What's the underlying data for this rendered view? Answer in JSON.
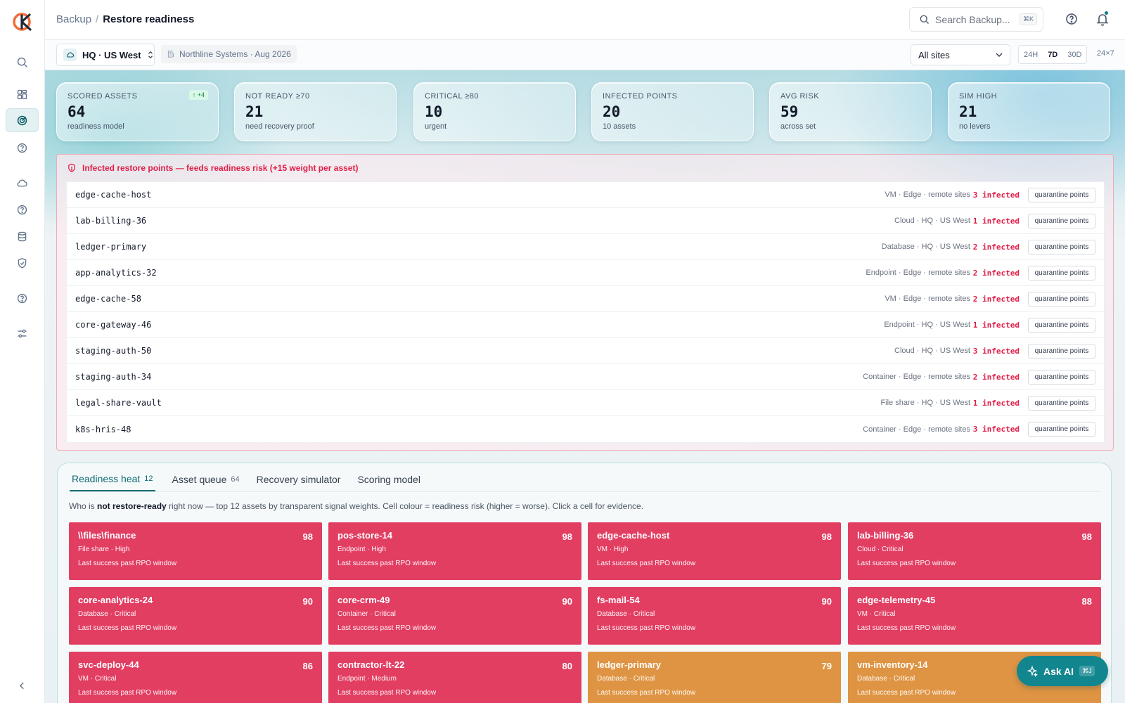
{
  "header": {
    "breadcrumb_parent": "Backup",
    "breadcrumb_separator": "/",
    "breadcrumb_current": "Restore readiness",
    "search_placeholder": "Search Backup...",
    "search_shortcut": "⌘K"
  },
  "subbar": {
    "site_label": "HQ · US West",
    "org_label": "Northline Systems · Aug 2026",
    "sites_filter": "All sites",
    "ranges": [
      "24H",
      "7D",
      "30D"
    ],
    "active_range": "7D",
    "range_extra": "24×7"
  },
  "sidebar": {
    "icons": [
      "logo-icon",
      "search-icon",
      "dashboard-icon",
      "readiness-target-icon",
      "help-circle-icon",
      "cloud-icon",
      "help-circle-icon",
      "database-icon",
      "shield-check-icon",
      "help-circle-icon",
      "sliders-icon",
      "collapse-chevron-icon"
    ]
  },
  "kpis": [
    {
      "label": "SCORED ASSETS",
      "value": "64",
      "sub": "readiness model",
      "delta": "↑ +4"
    },
    {
      "label": "NOT READY ≥70",
      "value": "21",
      "sub": "need recovery proof"
    },
    {
      "label": "CRITICAL ≥80",
      "value": "10",
      "sub": "urgent"
    },
    {
      "label": "INFECTED POINTS",
      "value": "20",
      "sub": "10 assets"
    },
    {
      "label": "AVG RISK",
      "value": "59",
      "sub": "across set"
    },
    {
      "label": "SIM HIGH",
      "value": "21",
      "sub": "no levers"
    }
  ],
  "infected": {
    "title": "Infected restore points — feeds readiness risk (+15 weight per asset)",
    "action_label": "quarantine points",
    "rows": [
      {
        "name": "edge-cache-host",
        "meta": "VM · Edge · remote sites",
        "count": "3 infected"
      },
      {
        "name": "lab-billing-36",
        "meta": "Cloud · HQ · US West",
        "count": "1 infected"
      },
      {
        "name": "ledger-primary",
        "meta": "Database · HQ · US West",
        "count": "2 infected"
      },
      {
        "name": "app-analytics-32",
        "meta": "Endpoint · Edge · remote sites",
        "count": "2 infected"
      },
      {
        "name": "edge-cache-58",
        "meta": "VM · Edge · remote sites",
        "count": "2 infected"
      },
      {
        "name": "core-gateway-46",
        "meta": "Endpoint · HQ · US West",
        "count": "1 infected"
      },
      {
        "name": "staging-auth-50",
        "meta": "Cloud · HQ · US West",
        "count": "3 infected"
      },
      {
        "name": "staging-auth-34",
        "meta": "Container · Edge · remote sites",
        "count": "2 infected"
      },
      {
        "name": "legal-share-vault",
        "meta": "File share · HQ · US West",
        "count": "1 infected"
      },
      {
        "name": "k8s-hris-48",
        "meta": "Container · Edge · remote sites",
        "count": "3 infected"
      }
    ]
  },
  "tabs": [
    {
      "label": "Readiness heat",
      "count": "12",
      "active": true
    },
    {
      "label": "Asset queue",
      "count": "64"
    },
    {
      "label": "Recovery simulator",
      "count": ""
    },
    {
      "label": "Scoring model",
      "count": ""
    }
  ],
  "heat": {
    "desc_prefix": "Who is ",
    "desc_bold": "not restore-ready",
    "desc_suffix": " right now — top 12 assets by transparent signal weights. Cell colour = readiness risk (higher = worse). Click a cell for evidence.",
    "cells": [
      {
        "name": "\\\\files\\finance",
        "score": "98",
        "meta": "File share · High",
        "note": "Last success past RPO window",
        "color": "#e23e62"
      },
      {
        "name": "pos-store-14",
        "score": "98",
        "meta": "Endpoint · High",
        "note": "Last success past RPO window",
        "color": "#e23e62"
      },
      {
        "name": "edge-cache-host",
        "score": "98",
        "meta": "VM · High",
        "note": "Last success past RPO window",
        "color": "#e23e62"
      },
      {
        "name": "lab-billing-36",
        "score": "98",
        "meta": "Cloud · Critical",
        "note": "Last success past RPO window",
        "color": "#e23e62"
      },
      {
        "name": "core-analytics-24",
        "score": "90",
        "meta": "Database · Critical",
        "note": "Last success past RPO window",
        "color": "#e23e62"
      },
      {
        "name": "core-crm-49",
        "score": "90",
        "meta": "Container · Critical",
        "note": "Last success past RPO window",
        "color": "#e23e62"
      },
      {
        "name": "fs-mail-54",
        "score": "90",
        "meta": "Database · Critical",
        "note": "Last success past RPO window",
        "color": "#e23e62"
      },
      {
        "name": "edge-telemetry-45",
        "score": "88",
        "meta": "VM · Critical",
        "note": "Last success past RPO window",
        "color": "#e23e62"
      },
      {
        "name": "svc-deploy-44",
        "score": "86",
        "meta": "VM · Critical",
        "note": "Last success past RPO window",
        "color": "#e23e62"
      },
      {
        "name": "contractor-lt-22",
        "score": "80",
        "meta": "Endpoint · Medium",
        "note": "Last success past RPO window",
        "color": "#e23e62"
      },
      {
        "name": "ledger-primary",
        "score": "79",
        "meta": "Database · Critical",
        "note": "Last success past RPO window",
        "color": "#df9443"
      },
      {
        "name": "vm-inventory-14",
        "score": "",
        "meta": "Database · Critical",
        "note": "Last success past RPO window",
        "color": "#df9443"
      }
    ]
  },
  "ask_ai": {
    "label": "Ask AI",
    "shortcut": "⌘J"
  }
}
